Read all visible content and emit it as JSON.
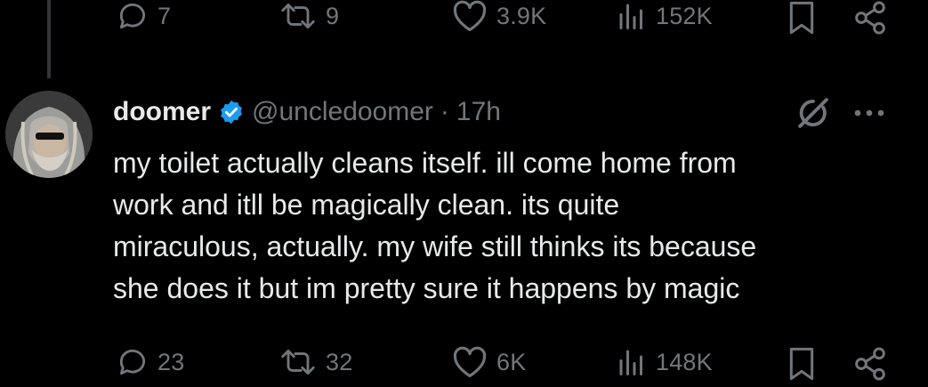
{
  "previous_tweet": {
    "actions": {
      "replies": "7",
      "reposts": "9",
      "likes": "3.9K",
      "views": "152K"
    }
  },
  "tweet": {
    "author": {
      "display_name": "doomer",
      "handle": "@uncledoomer",
      "verified": true
    },
    "separator": "·",
    "time": "17h",
    "text": "my toilet actually cleans itself. ill come home from\nwork and itll be magically clean. its quite\nmiraculous, actually. my wife still thinks its because\nshe does it but im pretty sure it happens by magic",
    "actions": {
      "replies": "23",
      "reposts": "32",
      "likes": "6K",
      "views": "148K"
    }
  },
  "icons": [
    "reply-icon",
    "repost-icon",
    "like-icon",
    "views-icon",
    "bookmark-icon",
    "share-icon",
    "verified-badge-icon",
    "grok-icon",
    "more-icon"
  ],
  "colors": {
    "background": "#000000",
    "text_primary": "#e7e9ea",
    "text_secondary": "#71767b",
    "verified_blue": "#1d9bf0",
    "thread_line": "#333639"
  }
}
